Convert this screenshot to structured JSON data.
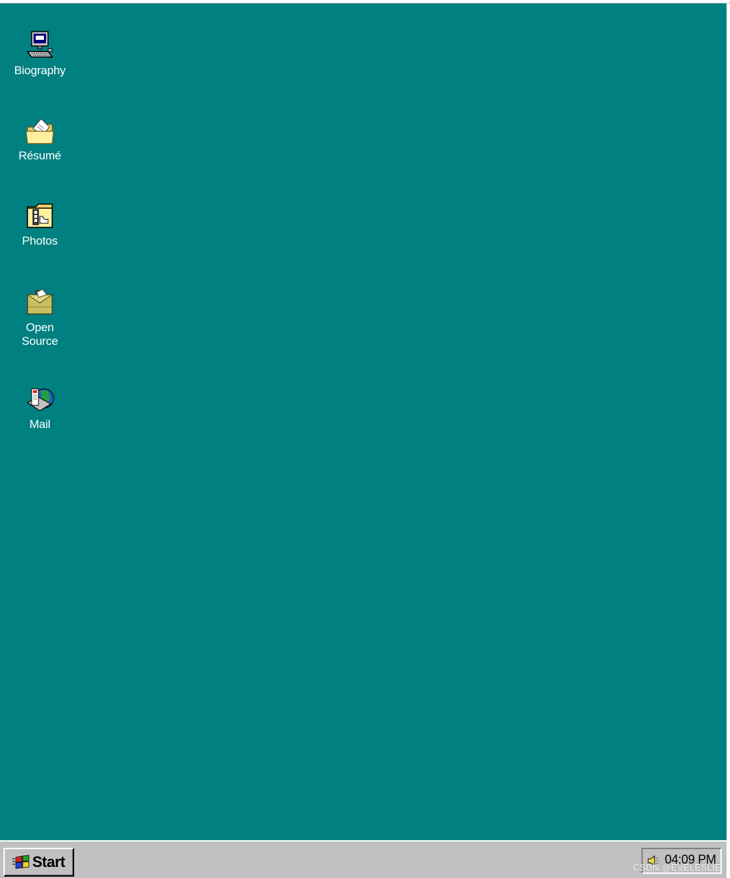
{
  "desktop": {
    "background_color": "#008080",
    "icons": [
      {
        "label": "Biography",
        "icon": "computer-icon"
      },
      {
        "label": "Résumé",
        "icon": "folder-document-icon"
      },
      {
        "label": "Photos",
        "icon": "photos-folder-icon"
      },
      {
        "label": "Open\nSource",
        "icon": "briefcase-icon"
      },
      {
        "label": "Mail",
        "icon": "mail-globe-icon"
      }
    ]
  },
  "taskbar": {
    "background_color": "#c0c0c0",
    "start_label": "Start",
    "tray": {
      "icon": "speaker-icon",
      "clock": "04:09 PM"
    },
    "watermark": "CSDN @EVELESLIE"
  }
}
